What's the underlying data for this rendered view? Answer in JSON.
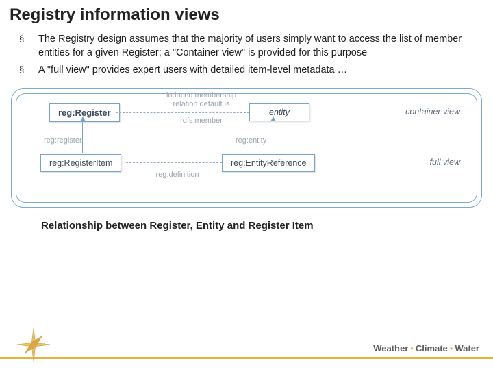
{
  "title": "Registry information views",
  "bullets": [
    "The Registry design assumes that the majority of users simply want to access the list of member entities for a given Register; a \"Container view\" is provided for this purpose",
    "A \"full view\" provides expert users with detailed item-level metadata …"
  ],
  "diagram": {
    "nodes": {
      "register": "reg:Register",
      "entity": "entity",
      "register_item": "reg:RegisterItem",
      "entity_reference": "reg:EntityReference"
    },
    "notes": {
      "top_note_1": "induced membership",
      "top_note_2": "relation default is",
      "rdfs_member": "rdfs:member",
      "reg_register": "reg:register",
      "reg_entity": "reg:entity",
      "reg_definition": "reg:definition"
    },
    "views": {
      "container": "container view",
      "full": "full view"
    }
  },
  "caption": "Relationship between Register, Entity and Register Item",
  "footer": {
    "w1": "Weather",
    "w2": "Climate",
    "w3": "Water"
  }
}
